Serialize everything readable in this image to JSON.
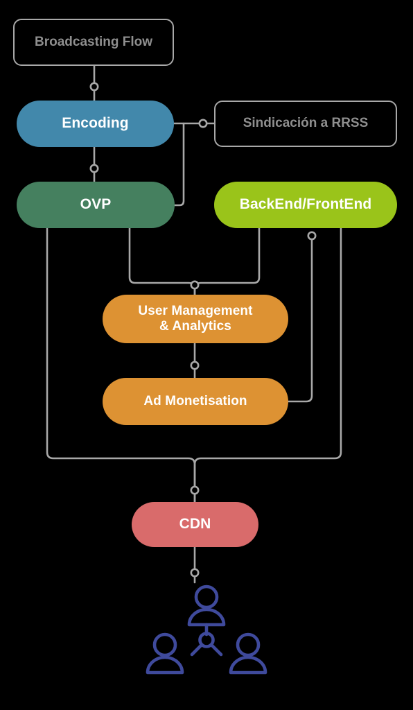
{
  "diagram": {
    "title": "Broadcasting Flow",
    "background_color": "#000000",
    "connector_color": "#a8a8a8",
    "nodes": [
      {
        "id": "broadcasting-flow",
        "label": "Broadcasting Flow",
        "style": "outline",
        "fill": "none",
        "border_color": "#a8a8a8",
        "text_color": "#8f8f8f"
      },
      {
        "id": "encoding",
        "label": "Encoding",
        "style": "pill",
        "fill": "#4288ab",
        "text_color": "#ffffff"
      },
      {
        "id": "sindicacion",
        "label": "Sindicación a RRSS",
        "style": "outline",
        "fill": "none",
        "border_color": "#a8a8a8",
        "text_color": "#8f8f8f"
      },
      {
        "id": "ovp",
        "label": "OVP",
        "style": "pill",
        "fill": "#45805f",
        "text_color": "#ffffff"
      },
      {
        "id": "backend-frontend",
        "label": "BackEnd/FrontEnd",
        "style": "pill",
        "fill": "#9ac41a",
        "text_color": "#ffffff"
      },
      {
        "id": "user-management",
        "label": "User Management\n& Analytics",
        "style": "pill",
        "fill": "#dd9233",
        "text_color": "#ffffff"
      },
      {
        "id": "ad-monetisation",
        "label": "Ad Monetisation",
        "style": "pill",
        "fill": "#dd9233",
        "text_color": "#ffffff"
      },
      {
        "id": "cdn",
        "label": "CDN",
        "style": "pill",
        "fill": "#d96b6b",
        "text_color": "#ffffff"
      }
    ],
    "audience": {
      "icon": "people-network-icon",
      "color": "#3f4a9c",
      "person_count": 3
    },
    "connections": [
      {
        "from": "broadcasting-flow",
        "to": "encoding"
      },
      {
        "from": "encoding",
        "to": "sindicacion"
      },
      {
        "from": "encoding",
        "to": "ovp"
      },
      {
        "from": "encoding",
        "to": "ovp-right"
      },
      {
        "from": "ovp",
        "to": "user-management"
      },
      {
        "from": "backend-frontend",
        "to": "user-management"
      },
      {
        "from": "user-management",
        "to": "ad-monetisation"
      },
      {
        "from": "backend-frontend",
        "to": "ad-monetisation"
      },
      {
        "from": "ovp",
        "to": "cdn"
      },
      {
        "from": "backend-frontend",
        "to": "cdn"
      },
      {
        "from": "cdn",
        "to": "audience"
      }
    ]
  }
}
